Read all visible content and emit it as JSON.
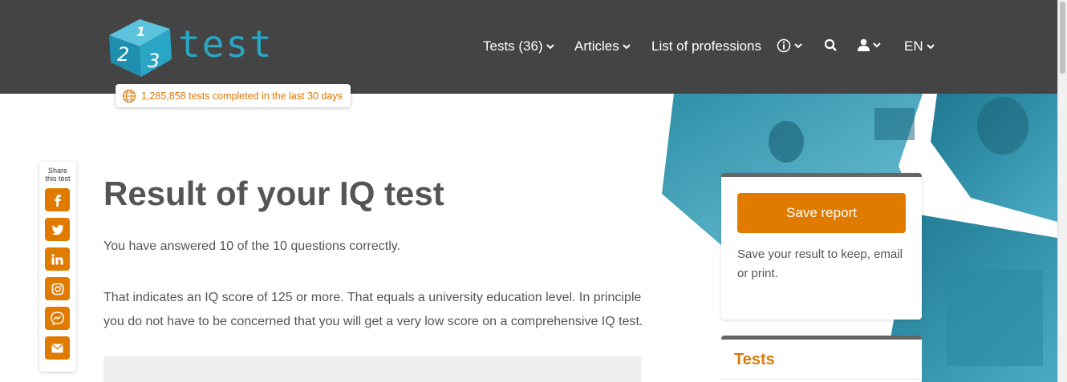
{
  "header": {
    "logo_text": "test",
    "logo_digits": [
      "2",
      "1",
      "3"
    ],
    "nav": {
      "tests": "Tests (36)",
      "articles": "Articles",
      "professions": "List of professions",
      "lang": "EN"
    },
    "counter": "1,285,858 tests completed in the last 30 days"
  },
  "share": {
    "title_line1": "Share",
    "title_line2": "this test",
    "buttons": [
      "facebook-icon",
      "twitter-icon",
      "linkedin-icon",
      "instagram-icon",
      "messenger-icon",
      "email-icon"
    ]
  },
  "main": {
    "title": "Result of your IQ test",
    "answered": "You have answered 10 of the 10 questions correctly.",
    "score_text": "That indicates an IQ score of 125 or more. That equals a university education level. In principle you do not have to be concerned that you will get a very low score on a comprehensive IQ test."
  },
  "sidebar": {
    "save_button": "Save report",
    "save_text": "Save your result to keep, email or print.",
    "tests_heading": "Tests"
  },
  "colors": {
    "header_bg": "#444444",
    "accent_orange": "#e07b00",
    "logo_teal": "#2aa6c4"
  }
}
